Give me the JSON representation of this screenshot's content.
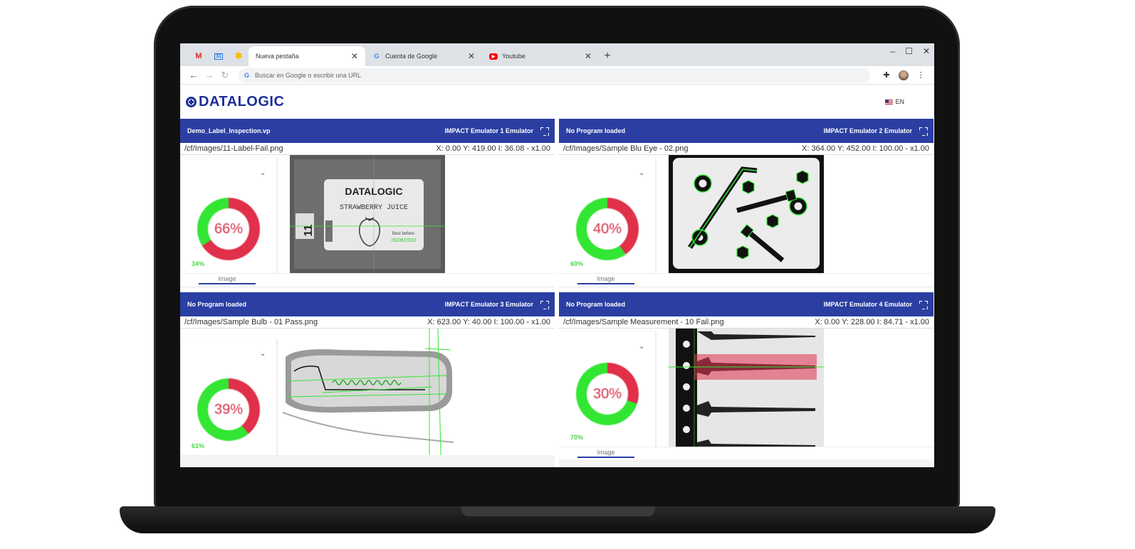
{
  "browser": {
    "tabs": [
      {
        "title": "Nueva pestaña",
        "active": true
      },
      {
        "title": "Cuenta de Google",
        "active": false
      },
      {
        "title": "Youtube",
        "active": false
      }
    ],
    "omnibox_placeholder": "Buscar en Google o escribir una URL"
  },
  "app": {
    "logo": "DATALOGIC",
    "language": "EN"
  },
  "panels": [
    {
      "program": "Demo_Label_Inspection.vp",
      "emulator": "IMPACT Emulator 1 Emulator",
      "path": "/cf/Images/11-Label-Fail.png",
      "coords": "X: 0.00 Y: 419.00  I: 36.08  - x1.00",
      "fail_pct": "66%",
      "pass_pct": "34%",
      "fail_value": 66,
      "image_tab": "Image",
      "label_text": {
        "brand": "DATALOGIC",
        "product": "STRAWBERRY JUICE",
        "best_before": "Best before:",
        "date": "06/06/2020",
        "lot": "11"
      }
    },
    {
      "program": "No Program loaded",
      "emulator": "IMPACT Emulator 2 Emulator",
      "path": "/cf/Images/Sample Blu Eye - 02.png",
      "coords": "X: 364.00 Y: 452.00  I: 100.00  - x1.00",
      "fail_pct": "40%",
      "pass_pct": "60%",
      "fail_value": 40,
      "image_tab": "Image"
    },
    {
      "program": "No Program loaded",
      "emulator": "IMPACT Emulator 3 Emulator",
      "path": "/cf/Images/Sample Bulb - 01 Pass.png",
      "coords": "X: 623.00 Y: 40.00  I: 100.00  - x1.00",
      "fail_pct": "39%",
      "pass_pct": "61%",
      "fail_value": 39
    },
    {
      "program": "No Program loaded",
      "emulator": "IMPACT Emulator 4 Emulator",
      "path": "/cf/Images/Sample Measurement - 10 Fail.png",
      "coords": "X: 0.00 Y: 228.00  I: 84.71  - x1.00",
      "fail_pct": "30%",
      "pass_pct": "70%",
      "fail_value": 30,
      "image_tab": "Image"
    }
  ],
  "colors": {
    "brand_blue": "#1e2f96",
    "header_blue": "#2b3fa3",
    "pass_green": "#33e633",
    "fail_red": "#e0304a"
  }
}
